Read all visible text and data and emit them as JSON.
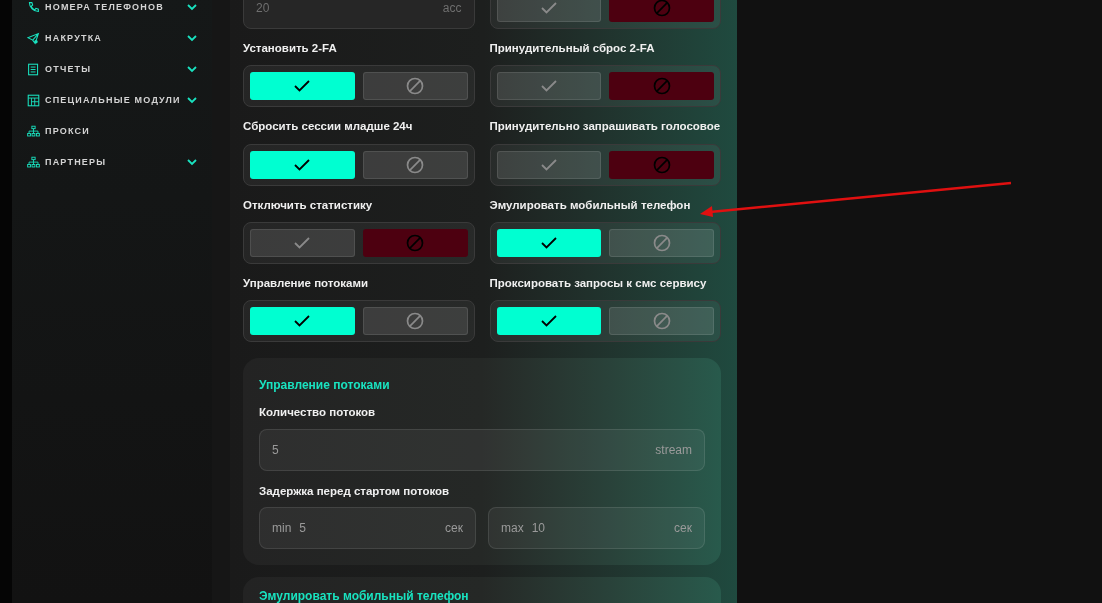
{
  "sidebar": {
    "items": [
      {
        "label": "НОМЕРА ТЕЛЕФОНОВ",
        "expandable": true
      },
      {
        "label": "НАКРУТКА",
        "expandable": true
      },
      {
        "label": "ОТЧЕТЫ",
        "expandable": true
      },
      {
        "label": "СПЕЦИАЛЬНЫЕ МОДУЛИ",
        "expandable": true
      },
      {
        "label": "ПРОКСИ",
        "expandable": false
      },
      {
        "label": "ПАРТНЕРЫ",
        "expandable": true
      }
    ]
  },
  "settings": [
    {
      "kind": "field",
      "value": "20",
      "unit": "acc"
    },
    {
      "kind": "toggle",
      "on": false
    },
    {
      "kind": "toggle",
      "label": "Установить 2-FA",
      "on": true
    },
    {
      "kind": "toggle",
      "label": "Принудительный сброс 2-FA",
      "on": false
    },
    {
      "kind": "toggle",
      "label": "Сбросить сессии младше 24ч",
      "on": true
    },
    {
      "kind": "toggle",
      "label": "Принудительно запрашивать голосовое",
      "on": false
    },
    {
      "kind": "toggle",
      "label": "Отключить статистику",
      "on": false
    },
    {
      "kind": "toggle",
      "label": "Эмулировать мобильный телефон",
      "on": true
    },
    {
      "kind": "toggle",
      "label": "Управление потоками",
      "on": true
    },
    {
      "kind": "toggle",
      "label": "Проксировать запросы к смс сервису",
      "on": true
    }
  ],
  "threads_card": {
    "title": "Управление потоками",
    "count_label": "Количество потоков",
    "count": {
      "value": "5",
      "unit": "stream"
    },
    "delay_label": "Задержка перед стартом потоков",
    "delay_min": {
      "prefix": "min",
      "value": "5",
      "unit": "сек"
    },
    "delay_max": {
      "prefix": "max",
      "value": "10",
      "unit": "сек"
    }
  },
  "emulate_card": {
    "title": "Эмулировать мобильный телефон"
  }
}
